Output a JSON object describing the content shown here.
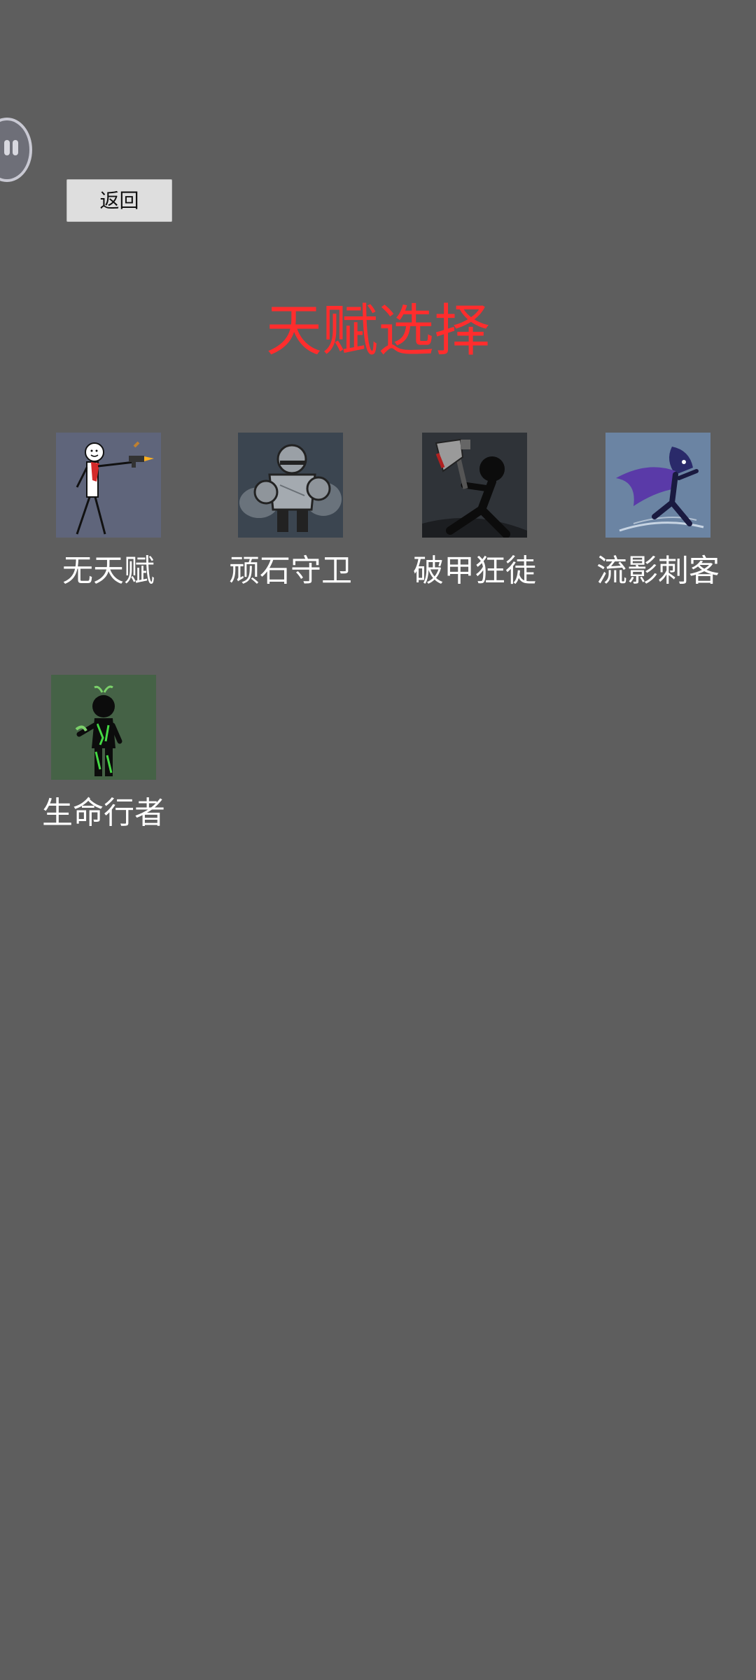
{
  "header": {
    "back_label": "返回",
    "title": "天赋选择"
  },
  "colors": {
    "background": "#5e5e5e",
    "title": "#ff2d2d",
    "label": "#ffffff",
    "button_bg": "#dedede"
  },
  "talents": [
    {
      "label": "无天赋",
      "icon": "gunner-stickman-icon"
    },
    {
      "label": "顽石守卫",
      "icon": "stone-guardian-icon"
    },
    {
      "label": "破甲狂徒",
      "icon": "axe-berserker-icon"
    },
    {
      "label": "流影刺客",
      "icon": "shadow-assassin-icon"
    },
    {
      "label": "生命行者",
      "icon": "life-walker-icon"
    }
  ]
}
